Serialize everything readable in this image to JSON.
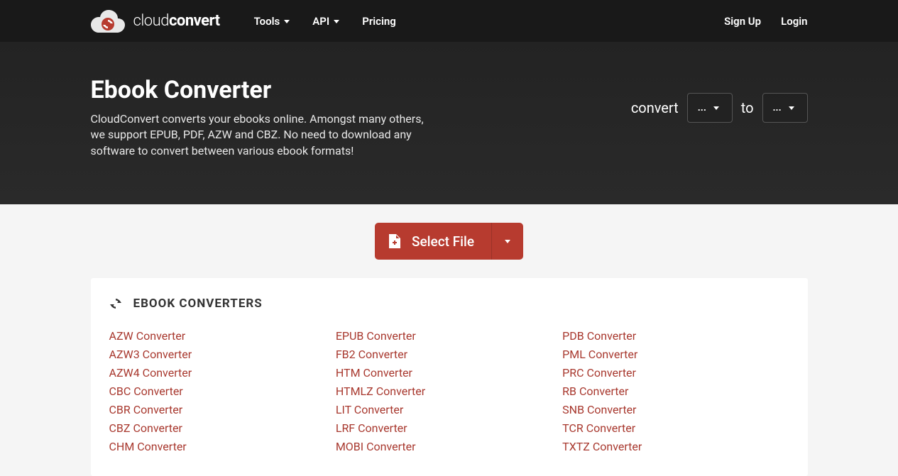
{
  "header": {
    "logo": {
      "part1": "cloud",
      "part2": "convert"
    },
    "nav_left": [
      {
        "label": "Tools",
        "has_dropdown": true
      },
      {
        "label": "API",
        "has_dropdown": true
      },
      {
        "label": "Pricing",
        "has_dropdown": false
      }
    ],
    "nav_right": [
      {
        "label": "Sign Up"
      },
      {
        "label": "Login"
      }
    ]
  },
  "hero": {
    "title": "Ebook Converter",
    "description": "CloudConvert converts your ebooks online. Amongst many others, we support EPUB, PDF, AZW and CBZ. No need to download any software to convert between various ebook formats!",
    "convert_label": "convert",
    "to_label": "to",
    "from_format": "...",
    "to_format": "..."
  },
  "select_file": {
    "label": "Select File"
  },
  "converters": {
    "title": "EBOOK CONVERTERS",
    "columns": [
      [
        "AZW Converter",
        "AZW3 Converter",
        "AZW4 Converter",
        "CBC Converter",
        "CBR Converter",
        "CBZ Converter",
        "CHM Converter"
      ],
      [
        "EPUB Converter",
        "FB2 Converter",
        "HTM Converter",
        "HTMLZ Converter",
        "LIT Converter",
        "LRF Converter",
        "MOBI Converter"
      ],
      [
        "PDB Converter",
        "PML Converter",
        "PRC Converter",
        "RB Converter",
        "SNB Converter",
        "TCR Converter",
        "TXTZ Converter"
      ]
    ]
  }
}
